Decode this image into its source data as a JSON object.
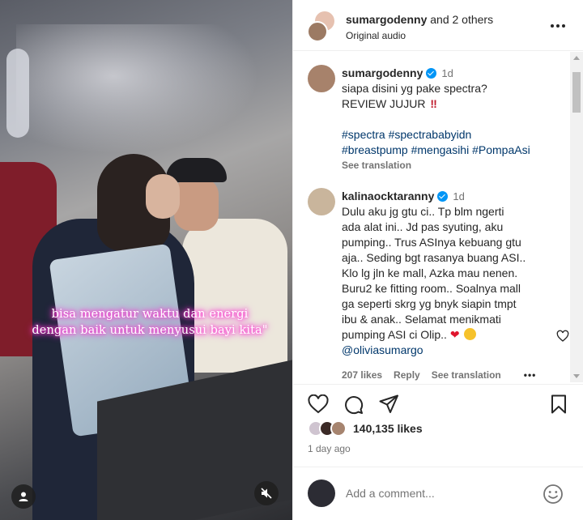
{
  "video": {
    "caption_line1": "bisa mengatur waktu dan energi",
    "caption_line2": "dengan baik untuk menyusui bayi kita\""
  },
  "header": {
    "username": "sumargodenny",
    "others": " and 2 others",
    "audio": "Original audio"
  },
  "caption_post": {
    "username": "sumargodenny",
    "time": "1d",
    "line1": "siapa disini yg pake spectra?",
    "line2": "REVIEW JUJUR",
    "hashtags_line1": "#spectra #spectrababyidn",
    "hashtags_line2": "#breastpump #mengasihi #PompaAsi",
    "see_translation": "See translation"
  },
  "comment": {
    "username": "kalinaocktaranny",
    "time": "1d",
    "lines": [
      "Dulu aku jg gtu ci.. Tp blm ngerti",
      "ada alat ini.. Jd pas syuting, aku",
      "pumping.. Trus ASInya kebuang gtu",
      "aja.. Seding bgt rasanya buang ASI..",
      "Klo lg jln ke mall, Azka mau nenen.",
      "Buru2 ke fitting room.. Soalnya mall",
      "ga seperti skrg yg bnyk siapin tmpt",
      "ibu & anak.. Selamat menikmati",
      "pumping ASI ci Olip.."
    ],
    "mention": "@oliviasumargo",
    "likes": "207 likes",
    "reply": "Reply",
    "see_translation": "See translation"
  },
  "actions": {
    "likes_count": "140,135 likes",
    "date": "1 day ago"
  },
  "add_comment": {
    "placeholder": "Add a comment..."
  },
  "colors": {
    "link": "#00376b",
    "verified": "#0095f6",
    "secondary_text": "#737373",
    "caption_glow": "#ff2fd0"
  }
}
